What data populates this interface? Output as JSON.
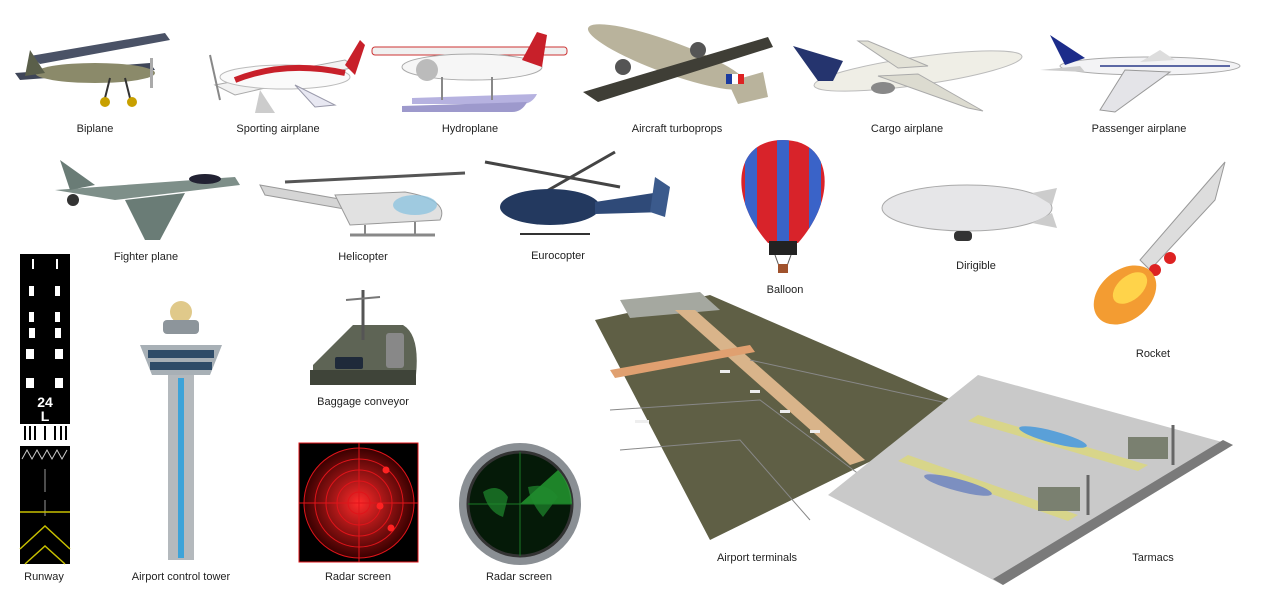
{
  "items": [
    {
      "label": "Biplane"
    },
    {
      "label": "Sporting airplane"
    },
    {
      "label": "Hydroplane"
    },
    {
      "label": "Aircraft turboprops"
    },
    {
      "label": "Cargo airplane"
    },
    {
      "label": "Passenger airplane"
    },
    {
      "label": "Fighter plane"
    },
    {
      "label": "Helicopter"
    },
    {
      "label": "Eurocopter"
    },
    {
      "label": "Balloon"
    },
    {
      "label": "Dirigible"
    },
    {
      "label": "Rocket"
    },
    {
      "label": "Baggage conveyor"
    },
    {
      "label": "Runway"
    },
    {
      "label": "Airport control tower"
    },
    {
      "label": "Radar screen"
    },
    {
      "label": "Radar screen"
    },
    {
      "label": "Airport terminals"
    },
    {
      "label": "Tarmacs"
    }
  ],
  "runway_markings": {
    "number": "24",
    "letter": "L"
  },
  "colors": {
    "radar_red": "#e0141a",
    "radar_green": "#2ecc40",
    "label_text": "#222222",
    "terrain": "#5f5f45",
    "tarmac": "#c9c9c9"
  }
}
